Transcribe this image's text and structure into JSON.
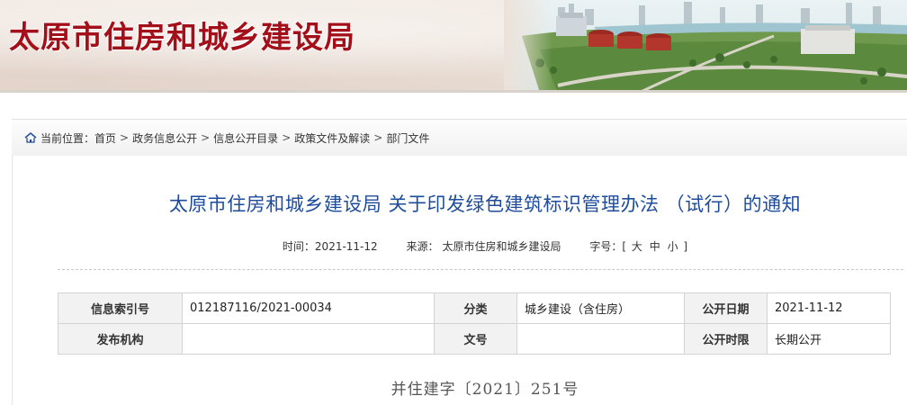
{
  "header": {
    "site_title": "太原市住房和城乡建设局"
  },
  "breadcrumb": {
    "prefix": "当前位置：",
    "items": [
      "首页",
      "政务信息公开",
      "信息公开目录",
      "政策文件及解读",
      "部门文件"
    ],
    "separator": ">"
  },
  "article": {
    "title": "太原市住房和城乡建设局 关于印发绿色建筑标识管理办法 （试行）的通知",
    "time_label": "时间：",
    "time_value": "2021-11-12",
    "source_label": "来源：",
    "source_value": "太原市住房和城乡建设局",
    "fontsize_label": "字号：[",
    "fontsize_large": "大",
    "fontsize_medium": "中",
    "fontsize_small": "小",
    "fontsize_close": "]",
    "doc_number": "并住建字〔2021〕251号"
  },
  "info_table": {
    "index_label": "信息索引号",
    "index_value": "012187116/2021-00034",
    "category_label": "分类",
    "category_value": "城乡建设（含住房）",
    "publish_date_label": "公开日期",
    "publish_date_value": "2021-11-12",
    "issuer_label": "发布机构",
    "issuer_value": "",
    "docno_label": "文号",
    "docno_value": "",
    "period_label": "公开时限",
    "period_value": "长期公开"
  },
  "colors": {
    "brand_red": "#a3101a",
    "title_blue": "#1e4c9c"
  }
}
